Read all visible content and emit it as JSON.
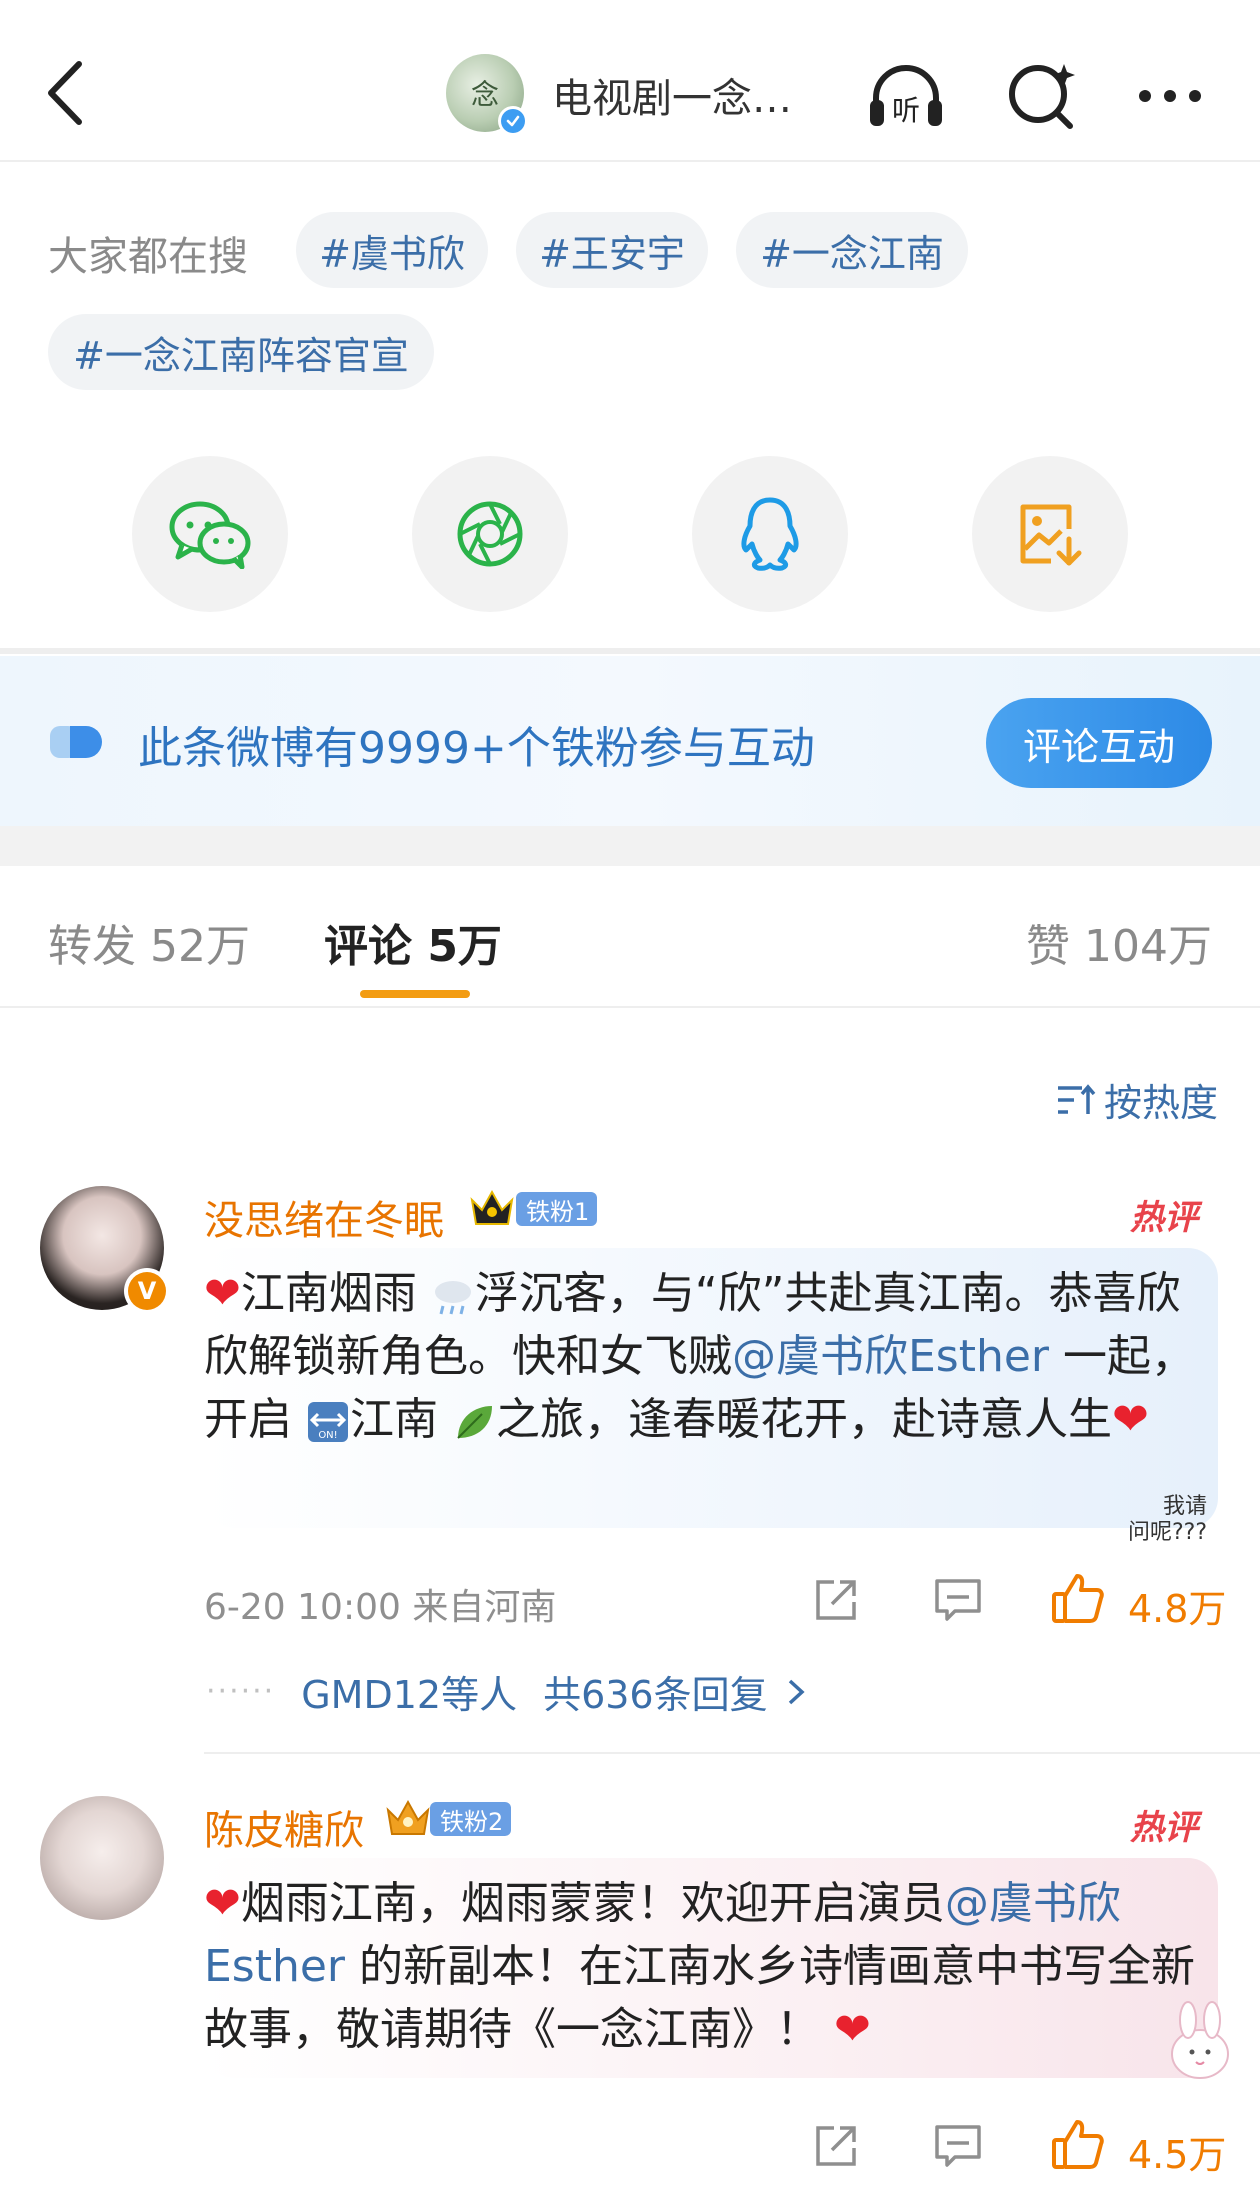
{
  "header": {
    "account_title": "电视剧一念…",
    "account_avatar_text": "念"
  },
  "trending": {
    "label": "大家都在搜",
    "chips": [
      "#虞书欣",
      "#王安宇",
      "#一念江南",
      "#一念江南阵容官宣"
    ]
  },
  "share": [
    {
      "name": "wechat",
      "color": "#2bb34a"
    },
    {
      "name": "moments",
      "color": "#2bb34a"
    },
    {
      "name": "qq",
      "color": "#1e9be6"
    },
    {
      "name": "save-image",
      "color": "#f0a020"
    }
  ],
  "banner": {
    "text": "此条微博有9999+个铁粉参与互动",
    "button": "评论互动"
  },
  "tabs": {
    "repost": "转发 52万",
    "comment": "评论 5万",
    "like": "赞 104万"
  },
  "sort": {
    "label": "按热度"
  },
  "comments": [
    {
      "username": "没思绪在冬眠",
      "fan_badge": "铁粉1",
      "hot_tag": "热评",
      "text_1": "江南烟雨",
      "text_2": "浮沉客，与“欣”共赴真江南。恭喜欣欣解锁新角色。快和女飞贼",
      "mention": "@虞书欣Esther",
      "text_3": " 一起， 开启",
      "text_4": "江南",
      "text_5": "之旅，逢春暖花开，赴诗意人生",
      "sticker_text_1": "我请",
      "sticker_text_2": "问呢???",
      "time_location": "6-20 10:00  来自河南",
      "likes": "4.8万",
      "reply_users": "GMD12等人",
      "reply_count": "共636条回复"
    },
    {
      "username": "陈皮糖欣",
      "fan_badge": "铁粉2",
      "hot_tag": "热评",
      "text_1": "烟雨江南，烟雨蒙蒙！欢迎开启演员",
      "mention": "@虞书欣Esther",
      "text_2": " 的新副本！在江南水乡诗情画意中书写全新故事，敬请期待《一念江南》！",
      "likes": "4.5万"
    }
  ]
}
